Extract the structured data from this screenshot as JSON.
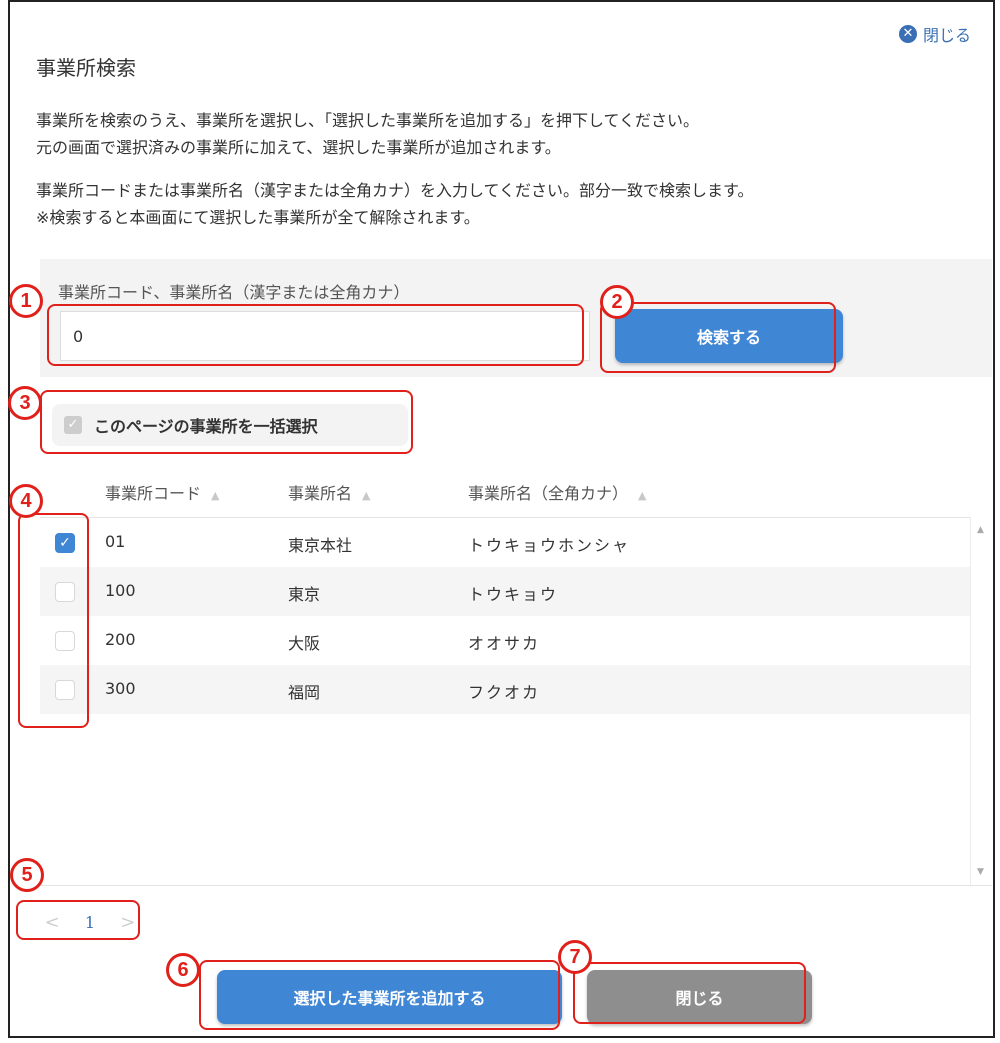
{
  "header": {
    "title": "事業所検索",
    "close_link": "閉じる"
  },
  "instructions": {
    "lines1": [
      "事業所を検索のうえ、事業所を選択し、「選択した事業所を追加する」を押下してください。",
      "元の画面で選択済みの事業所に加えて、選択した事業所が追加されます。"
    ],
    "lines2": [
      "事業所コードまたは事業所名（漢字または全角カナ）を入力してください。部分一致で検索します。",
      "※検索すると本画面にて選択した事業所が全て解除されます。"
    ]
  },
  "search": {
    "label": "事業所コード、事業所名（漢字または全角カナ）",
    "value": "0",
    "button": "検索する"
  },
  "bulk_select": {
    "label": "このページの事業所を一括選択",
    "checked": true,
    "disabled": true
  },
  "table": {
    "columns": [
      "事業所コード",
      "事業所名",
      "事業所名（全角カナ）"
    ],
    "rows": [
      {
        "checked": true,
        "code": "01",
        "name": "東京本社",
        "kana": "トウキョウホンシャ"
      },
      {
        "checked": false,
        "code": "100",
        "name": "東京",
        "kana": "トウキョウ"
      },
      {
        "checked": false,
        "code": "200",
        "name": "大阪",
        "kana": "オオサカ"
      },
      {
        "checked": false,
        "code": "300",
        "name": "福岡",
        "kana": "フクオカ"
      }
    ]
  },
  "pagination": {
    "current_page": "1",
    "prev": "<",
    "next": ">"
  },
  "footer": {
    "add_button": "選択した事業所を追加する",
    "close_button": "閉じる"
  },
  "annotations": [
    "1",
    "2",
    "3",
    "4",
    "5",
    "6",
    "7"
  ],
  "colors": {
    "primary": "#3f86d4",
    "annotation": "#e0211b",
    "close_button": "#8e8e8e",
    "link": "#3a6fb5"
  }
}
